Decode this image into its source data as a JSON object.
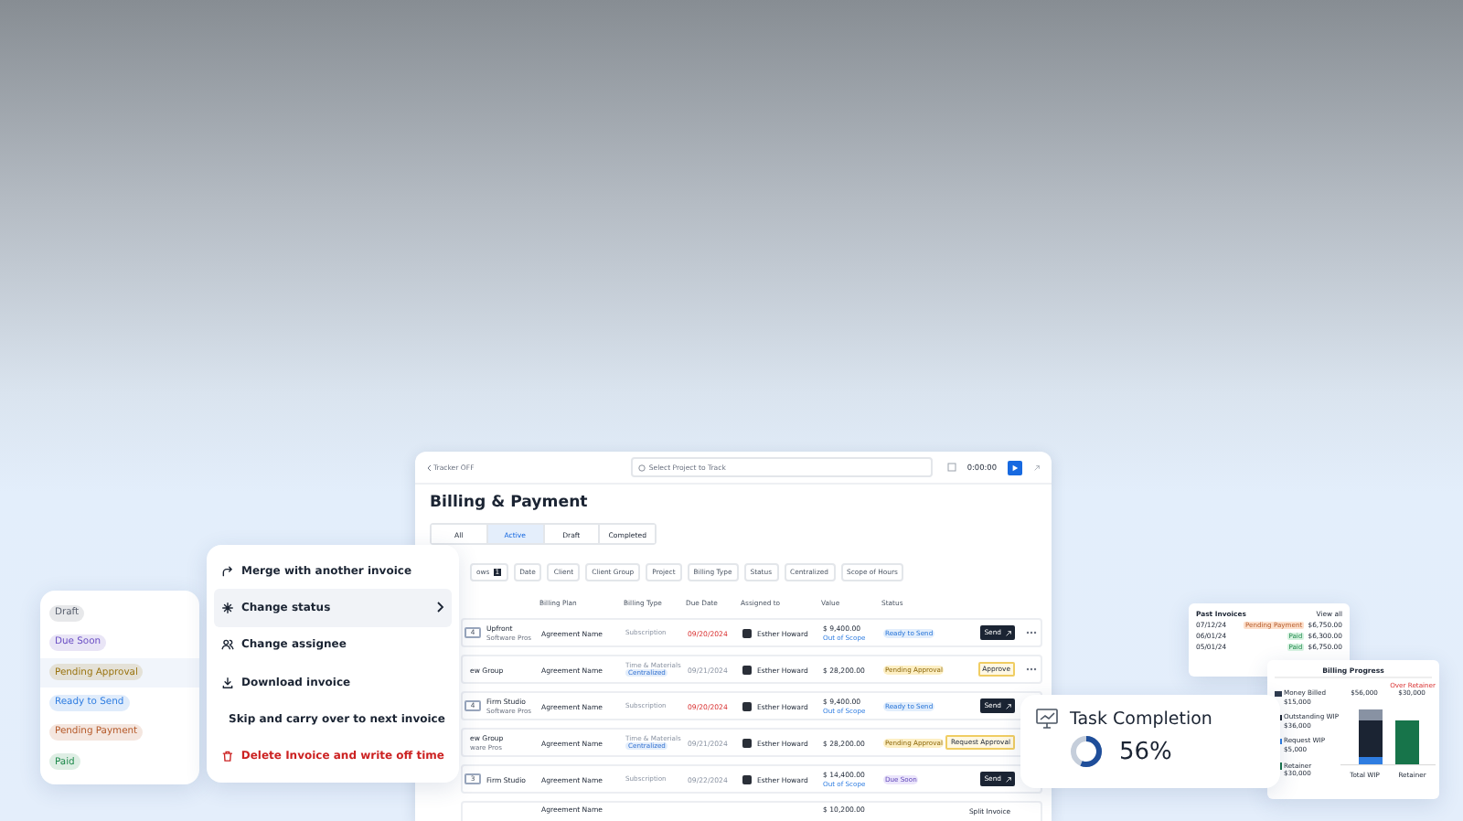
{
  "app": {
    "tracker": "Tracker OFF",
    "project_search": {
      "placeholder": "Select Project to Track"
    },
    "timer": "0:00:00",
    "title": "Billing & Payment",
    "tabs": [
      {
        "label": "All",
        "selected": false
      },
      {
        "label": "Active",
        "selected": true
      },
      {
        "label": "Draft",
        "selected": false
      },
      {
        "label": "Completed",
        "selected": false
      }
    ],
    "group_chip": {
      "label": "ows",
      "count": "1"
    },
    "filters": [
      "Date",
      "Client",
      "Client Group",
      "Project",
      "Billing Type",
      "Status",
      "Centralized",
      "Scope of Hours"
    ],
    "columns": [
      "",
      "Billing Plan",
      "Billing Type",
      "Due Date",
      "Assigned to",
      "Value",
      "Status"
    ],
    "rows": [
      {
        "client": "Upfront",
        "client_sub": "Software Pros",
        "count": "4",
        "plan": "Agreement Name",
        "type": "Subscription",
        "due": "09/20/2024",
        "overdue": true,
        "assignee": "Esther Howard",
        "value": "$ 9,400.00",
        "scope": "Out of Scope",
        "status": {
          "label": "Ready to Send",
          "kind": "ready"
        },
        "action": {
          "label": "Send",
          "kind": "send"
        },
        "more_button": true
      },
      {
        "client": "ew Group",
        "plan": "Agreement Name",
        "type": "Time & Materials",
        "tag": "Centralized",
        "due": "09/21/2024",
        "overdue": false,
        "assignee": "Esther Howard",
        "value": "$ 28,200.00",
        "status": {
          "label": "Pending Approval",
          "kind": "pending"
        },
        "action": {
          "label": "Approve",
          "kind": "approve"
        },
        "more_button": true
      },
      {
        "client": "Firm Studio",
        "client_sub": "Software Pros",
        "count": "4",
        "plan": "Agreement Name",
        "type": "Subscription",
        "due": "09/20/2024",
        "overdue": true,
        "assignee": "Esther Howard",
        "value": "$ 9,400.00",
        "scope": "Out of Scope",
        "status": {
          "label": "Ready to Send",
          "kind": "ready"
        },
        "action": {
          "label": "Send",
          "kind": "send"
        },
        "more_button": false
      },
      {
        "client": "ew Group",
        "client_sub": "ware Pros",
        "plan": "Agreement Name",
        "type": "Time & Materials",
        "tag": "Centralized",
        "due": "09/21/2024",
        "overdue": false,
        "assignee": "Esther Howard",
        "value": "$ 28,200.00",
        "status": {
          "label": "Pending Approval",
          "kind": "pending"
        },
        "action": {
          "label": "Request Approval",
          "kind": "approve"
        },
        "more_button": false
      },
      {
        "client": "Firm Studio",
        "count": "3",
        "plan": "Agreement Name",
        "type": "Subscription",
        "due": "09/22/2024",
        "overdue": false,
        "assignee": "Esther Howard",
        "value": "$ 14,400.00",
        "scope": "Out of Scope",
        "status": {
          "label": "Due Soon",
          "kind": "due"
        },
        "action": {
          "label": "Send",
          "kind": "send"
        },
        "more_button": false
      },
      {
        "plan": "Agreement Name",
        "value": "$ 10,200.00",
        "action": {
          "label": "Split Invoice",
          "kind": "link"
        },
        "more_button": false
      }
    ]
  },
  "status_list": [
    {
      "label": "Draft",
      "color": "#5b6270",
      "selected": false
    },
    {
      "label": "Due Soon",
      "color": "#6b4fc4",
      "selected": false
    },
    {
      "label": "Pending Approval",
      "color": "#9a7410",
      "selected": true
    },
    {
      "label": "Ready to Send",
      "color": "#2f7de1",
      "selected": false
    },
    {
      "label": "Pending Payment",
      "color": "#b55a2a",
      "selected": false
    },
    {
      "label": "Paid",
      "color": "#1f8a4c",
      "selected": false
    }
  ],
  "action_menu": [
    {
      "label": "Merge with another invoice",
      "kind": "merge",
      "selected": false
    },
    {
      "label": "Change status",
      "kind": "status",
      "selected": true
    },
    {
      "label": "Change assignee",
      "kind": "assignee",
      "selected": false
    },
    {
      "label": "Download invoice",
      "kind": "download",
      "selected": false
    },
    {
      "label": "Skip and carry over to next invoice",
      "kind": "skip",
      "selected": false
    },
    {
      "label": "Delete Invoice and write off time",
      "kind": "delete",
      "selected": false
    }
  ],
  "task_completion": {
    "title": "Task Completion",
    "level": 0.56,
    "reading": "56%"
  },
  "past_invoices": {
    "title": "Past Invoices",
    "link": "View all",
    "rows": [
      {
        "date": "07/12/24",
        "status": "Pending Payment",
        "kind": "pending",
        "amount": "$6,750.00"
      },
      {
        "date": "06/01/24",
        "status": "Paid",
        "kind": "paid",
        "amount": "$6,300.00"
      },
      {
        "date": "05/01/24",
        "status": "Paid",
        "kind": "paid",
        "amount": "$6,750.00"
      }
    ]
  },
  "billing_progress": {
    "title": "Billing Progress",
    "legend": [
      {
        "label": "Money Billed",
        "value": "$15,000",
        "color": "#2e3a4e"
      },
      {
        "label": "Outstanding WIP",
        "value": "$36,000",
        "color": "#1b2433"
      },
      {
        "label": "Request WIP",
        "value": "$5,000",
        "color": "#2f7de1"
      },
      {
        "label": "Retainer",
        "value": "$30,000",
        "color": "#17744a"
      }
    ],
    "limit_label": "Over Retainer",
    "bar_values": [
      "$56,000",
      "$30,000"
    ],
    "bar_labels": [
      "Total WIP",
      "Retainer"
    ]
  }
}
